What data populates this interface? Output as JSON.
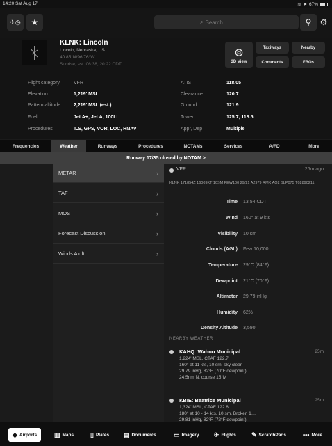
{
  "status": {
    "time": "14:20",
    "date": "Sat Aug 17",
    "right": "67%"
  },
  "toolbar": {
    "search_placeholder": "Search"
  },
  "airport": {
    "id_name": "KLNK: Lincoln",
    "location": "Lincoln, Nebraska, US",
    "coords": "40.85°N/96.76°W",
    "sun": "Sunrise, sst. 06:38, 20:22 CDT",
    "buttons": {
      "view3d": "3D View",
      "taxiways": "Taxiways",
      "nearby": "Nearby",
      "comments": "Comments",
      "fbos": "FBOs"
    }
  },
  "info": {
    "left": [
      {
        "label": "Flight category",
        "value": "VFR"
      },
      {
        "label": "Elevation",
        "value": "1,219' MSL"
      },
      {
        "label": "Pattern altitude",
        "value": "2,219' MSL (est.)"
      },
      {
        "label": "Fuel",
        "value": "Jet A+, Jet A, 100LL"
      },
      {
        "label": "Procedures",
        "value": "ILS, GPS, VOR, LOC, RNAV"
      }
    ],
    "right": [
      {
        "label": "ATIS",
        "value": "118.05"
      },
      {
        "label": "Clearance",
        "value": "120.7"
      },
      {
        "label": "Ground",
        "value": "121.9"
      },
      {
        "label": "Tower",
        "value": "125.7, 118.5"
      },
      {
        "label": "Appr, Dep",
        "value": "Multiple"
      }
    ]
  },
  "tabs": [
    "Frequencies",
    "Weather",
    "Runways",
    "Procedures",
    "NOTAMs",
    "Services",
    "A/FD",
    "More"
  ],
  "notam_banner": "Runway 17/35 closed by NOTAM >",
  "weather_menu": [
    "METAR",
    "TAF",
    "MOS",
    "Forecast Discussion",
    "Winds Aloft"
  ],
  "metar": {
    "category": "VFR",
    "age": "26m ago",
    "raw": "KLNK 171854Z 16009KT 10SM FEW100 29/21 A2979 RMK AO2 SLP075 T02890211",
    "fields": [
      {
        "k": "Time",
        "v": "13:54 CDT"
      },
      {
        "k": "Wind",
        "v": "160° at 9 kts"
      },
      {
        "k": "Visibility",
        "v": "10 sm"
      },
      {
        "k": "Clouds (AGL)",
        "v": "Few 10,000'"
      },
      {
        "k": "Temperature",
        "v": "29°C (84°F)"
      },
      {
        "k": "Dewpoint",
        "v": "21°C (70°F)"
      },
      {
        "k": "Altimeter",
        "v": "29.79 inHg"
      },
      {
        "k": "Humidity",
        "v": "62%"
      },
      {
        "k": "Density Altitude",
        "v": "3,590'"
      }
    ]
  },
  "nearby_label": "NEARBY WEATHER",
  "nearby": [
    {
      "title": "KAHQ: Wahoo Municipal",
      "dist": "25m",
      "lines": [
        "1,224' MSL, CTAF 122.7",
        "160° at 11 kts, 10 sm, sky clear",
        "29.79 inHg, 82°F (70°F dewpoint)",
        "24.5nm N, course 15°M"
      ]
    },
    {
      "title": "KBIE: Beatrice Municipal",
      "dist": "25m",
      "lines": [
        "1,324' MSL, CTAF 122.8",
        "180° at 10 - 14 kts, 10 sm, Broken 1…",
        "29.81 inHg, 82°F (72°F dewpoint)"
      ]
    }
  ],
  "bottom_nav": [
    "Airports",
    "Maps",
    "Plates",
    "Documents",
    "Imagery",
    "Flights",
    "ScratchPads",
    "More"
  ]
}
